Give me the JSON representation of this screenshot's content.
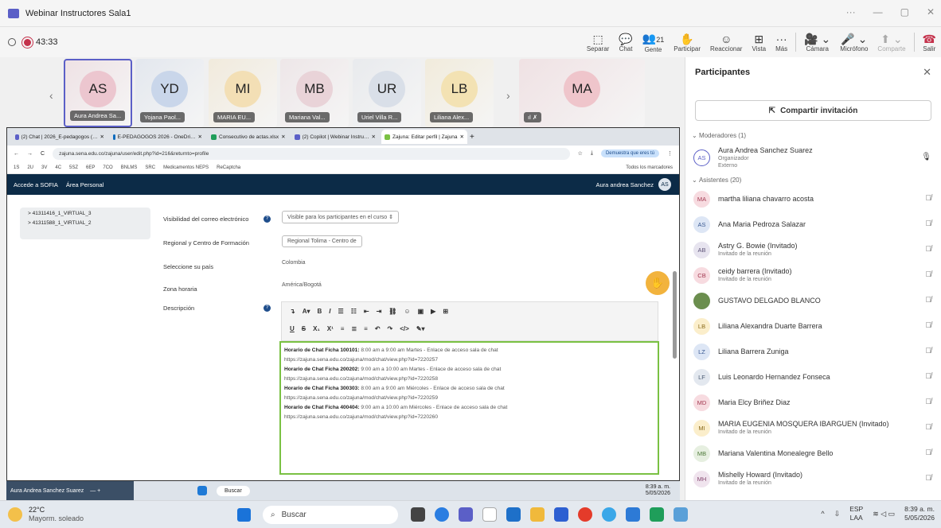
{
  "window": {
    "title": "Webinar Instructores Sala1",
    "min": "—",
    "restore": "▢",
    "close": "✕",
    "more": "···"
  },
  "meeting": {
    "timer": "43:33",
    "people_count": "21",
    "tools": [
      {
        "icon": "⬚",
        "label": "Separar"
      },
      {
        "icon": "💬",
        "label": "Chat"
      },
      {
        "icon": "👥",
        "label": "Gente"
      },
      {
        "icon": "✋",
        "label": "Participar"
      },
      {
        "icon": "☺",
        "label": "Reaccionar"
      },
      {
        "icon": "⊞",
        "label": "Vista"
      },
      {
        "icon": "···",
        "label": "Más"
      }
    ],
    "camera": "Cámara",
    "mic": "Micrófono",
    "share": "Comparte",
    "leave": "Salir"
  },
  "tiles": [
    {
      "initials": "AS",
      "name": "Aura Andrea Sa...",
      "color": "#ecc6cf"
    },
    {
      "initials": "YD",
      "name": "Yojana Paol...",
      "color": "#c9d6ea"
    },
    {
      "initials": "MI",
      "name": "MARIA EU...",
      "color": "#f3dfb5"
    },
    {
      "initials": "MB",
      "name": "Mariana Val...",
      "color": "#e9d3d8"
    },
    {
      "initials": "UR",
      "name": "Uriel Villa R...",
      "color": "#d9dfe8"
    },
    {
      "initials": "LB",
      "name": "Liliana Alex...",
      "color": "#f3e2b3"
    },
    {
      "initials": "MA",
      "name": "",
      "color": "#efc5cb"
    }
  ],
  "browser": {
    "tabs": [
      "(2) Chat | 2026_E-pedagogos (…",
      "E-PEDAGOGOS 2026 - OneDri…",
      "Consecutivo de actas.xlsx",
      "(2) Copilot | Webinar Instru…",
      "Zajuna: Editar perfil | Zajuna"
    ],
    "url": "zajuna.sena.edu.co/zajuna/user/edit.php?id=216&returnto=profile",
    "demuestra": "Demuestra que eres tú",
    "bookmarks": [
      "1S",
      "2U",
      "3V",
      "4C",
      "5SZ",
      "6EP",
      "7CO",
      "BNLMS",
      "SRC",
      "Medicamentos NEPS",
      "ReCaptcha"
    ],
    "all_bookmarks": "Todos los marcadores",
    "nav": [
      "Accede a SOFIA",
      "Área Personal"
    ],
    "user": "Aura andrea Sanchez",
    "user_initials": "AS",
    "side_items": [
      "> 41311416_1_VIRTUAL_3",
      "> 41311588_1_VIRTUAL_2"
    ],
    "form": {
      "email_vis_label": "Visibilidad del correo electrónico",
      "email_vis_value": "Visible para los participantes en el curso ⇕",
      "regional_label": "Regional y Centro de Formación",
      "regional_value": "Regional Tolima - Centro de",
      "country_label": "Seleccione su país",
      "country_value": "Colombia",
      "tz_label": "Zona horaria",
      "tz_value": "América/Bogotá",
      "desc_label": "Descripción"
    },
    "editor_lines": [
      {
        "b": "Horario de Chat Ficha 100101:",
        "t": " 8:00 am a 9:00 am Martes - Enlace de acceso sala de chat"
      },
      {
        "b": "",
        "t": "https://zajuna.sena.edu.co/zajuna/mod/chat/view.php?id=7220257"
      },
      {
        "b": "Horario de Chat Ficha 200202:",
        "t": " 9:00 am a 10:00 am Martes - Enlace de acceso sala de chat"
      },
      {
        "b": "",
        "t": "https://zajuna.sena.edu.co/zajuna/mod/chat/view.php?id=7220258"
      },
      {
        "b": "Horario de Chat Ficha 300303:",
        "t": " 8:00 am a 9:00 am Miércoles - Enlace de acceso sala de chat"
      },
      {
        "b": "",
        "t": "https://zajuna.sena.edu.co/zajuna/mod/chat/view.php?id=7220259"
      },
      {
        "b": "Horario de Chat Ficha 400404:",
        "t": " 9:00 am a 10:00 am Miércoles - Enlace de acceso sala de chat"
      },
      {
        "b": "",
        "t": "https://zajuna.sena.edu.co/zajuna/mod/chat/view.php?id=7220260"
      }
    ]
  },
  "inner_taskbar": {
    "who": "Aura Andrea Sanchez Suarez",
    "search": "Buscar",
    "lang": "ESP",
    "lang2": "LAA",
    "time": "8:39 a. m.",
    "date": "5/05/2026"
  },
  "panel": {
    "title": "Participantes",
    "share": "Compartir invitación",
    "moderators_header": "Moderadores (1)",
    "moderator": {
      "initials": "AS",
      "name": "Aura Andrea Sanchez Suarez",
      "role": "Organizador",
      "ext": "Externo"
    },
    "attendees_header": "Asistentes (20)",
    "attendees": [
      {
        "initials": "MA",
        "name": "martha liliana chavarro acosta",
        "sub": "",
        "color": "#f7dbe0",
        "fg": "#a33a52"
      },
      {
        "initials": "AS",
        "name": "Ana Maria Pedroza Salazar",
        "sub": "",
        "color": "#dde6f5",
        "fg": "#3a5a92"
      },
      {
        "initials": "AB",
        "name": "Astry G. Bowie (Invitado)",
        "sub": "Invitado de la reunión",
        "color": "#e7e4ef",
        "fg": "#5e5478"
      },
      {
        "initials": "CB",
        "name": "ceidy barrera (Invitado)",
        "sub": "Invitado de la reunión",
        "color": "#f7dbe0",
        "fg": "#a33a52"
      },
      {
        "initials": "GD",
        "name": "GUSTAVO DELGADO BLANCO",
        "sub": "",
        "color": "#6b8e4e",
        "fg": "#ffffff"
      },
      {
        "initials": "LB",
        "name": "Liliana Alexandra Duarte Barrera",
        "sub": "",
        "color": "#fbeecb",
        "fg": "#8a6a1a"
      },
      {
        "initials": "LZ",
        "name": "Liliana Barrera Zuniga",
        "sub": "",
        "color": "#dde6f5",
        "fg": "#3a5a92"
      },
      {
        "initials": "LF",
        "name": "Luis Leonardo Hernandez Fonseca",
        "sub": "",
        "color": "#e3e8ef",
        "fg": "#4a5a72"
      },
      {
        "initials": "MD",
        "name": "Maria Elcy Briñez Diaz",
        "sub": "",
        "color": "#f7dbe0",
        "fg": "#a33a52"
      },
      {
        "initials": "MI",
        "name": "MARIA EUGENIA MOSQUERA IBARGUEN (Invitado)",
        "sub": "Invitado de la reunión",
        "color": "#fbeecb",
        "fg": "#8a6a1a"
      },
      {
        "initials": "MB",
        "name": "Mariana Valentina Monealegre Bello",
        "sub": "",
        "color": "#e6efe0",
        "fg": "#4f7a3a"
      },
      {
        "initials": "MH",
        "name": "Mishelly Howard (Invitado)",
        "sub": "Invitado de la reunión",
        "color": "#f0e4ee",
        "fg": "#84466f"
      }
    ]
  },
  "taskbar": {
    "temp": "22°C",
    "weather": "Mayorm. soleado",
    "search": "Buscar",
    "lang": "ESP",
    "lang2": "LAA",
    "time": "8:39 a. m.",
    "date": "5/05/2026"
  }
}
